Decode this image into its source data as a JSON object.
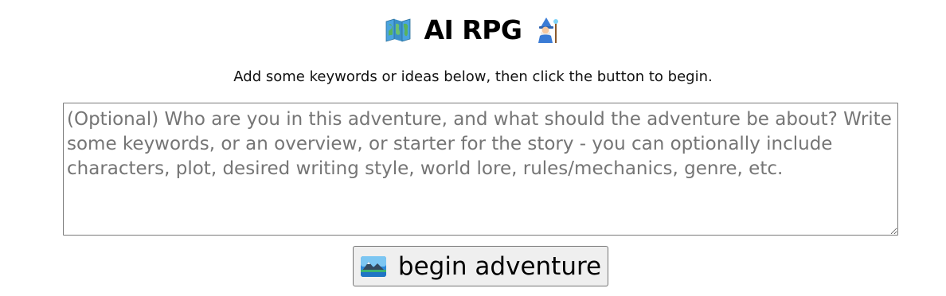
{
  "header": {
    "title": "AI RPG",
    "left_icon": "world-map-icon",
    "right_icon": "mage-icon"
  },
  "intro": {
    "text": "Add some keywords or ideas below, then click the button to begin."
  },
  "prompt": {
    "value": "",
    "placeholder": "(Optional) Who are you in this adventure, and what should the adventure be about? Write some keywords, or an overview, or starter for the story - you can optionally include characters, plot, desired writing style, world lore, rules/mechanics, genre, etc."
  },
  "begin_button": {
    "label": "begin adventure",
    "icon": "landscape-picture-icon"
  }
}
